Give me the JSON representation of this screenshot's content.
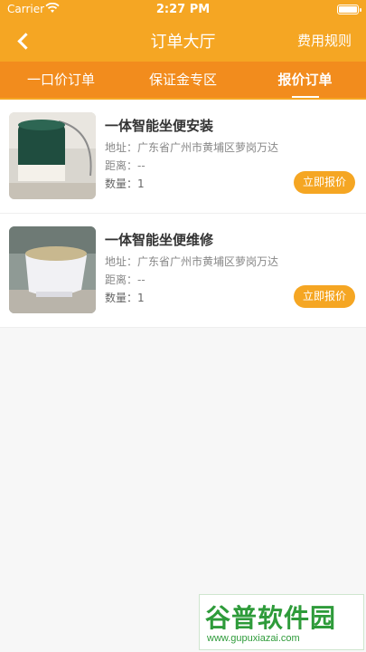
{
  "status": {
    "carrier": "Carrier",
    "time": "2:27 PM"
  },
  "nav": {
    "back": "<",
    "title": "订单大厅",
    "right": "费用规则"
  },
  "tabs": [
    {
      "label": "一口价订单",
      "active": false
    },
    {
      "label": "保证金专区",
      "active": false
    },
    {
      "label": "报价订单",
      "active": true
    }
  ],
  "orders": [
    {
      "title": "一体智能坐便安装",
      "address": "地址：广东省广州市黄埔区萝岗万达",
      "distance": "距离：--",
      "quantity": "数量：1",
      "button": "立即报价"
    },
    {
      "title": "一体智能坐便维修",
      "address": "地址：广东省广州市黄埔区萝岗万达",
      "distance": "距离：--",
      "quantity": "数量：1",
      "button": "立即报价"
    }
  ],
  "watermark": {
    "main": "谷普软件园",
    "url": "www.gupuxiazai.com"
  },
  "colors": {
    "accent": "#f5a623",
    "tab_bar": "#f28c1d"
  }
}
